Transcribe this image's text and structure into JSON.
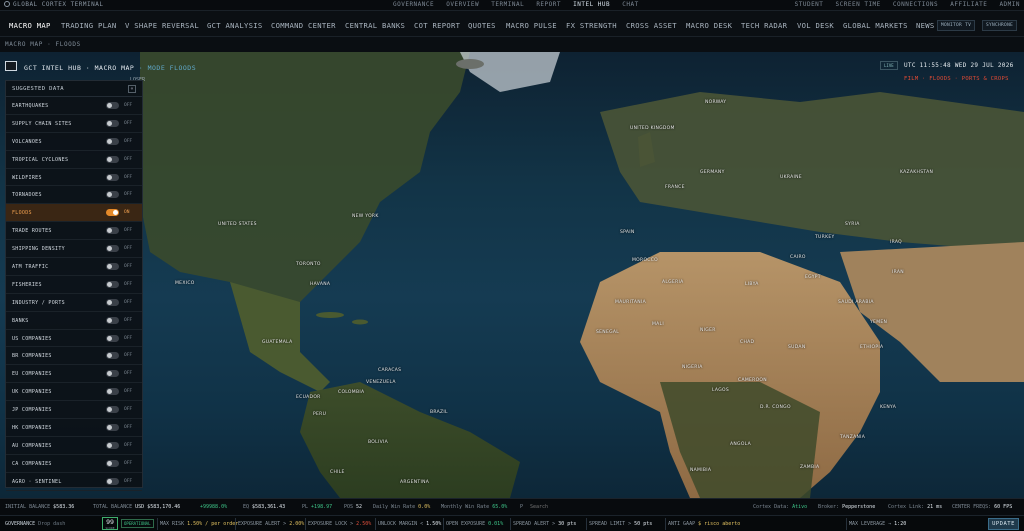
{
  "topbar": {
    "brand": "GLOBAL CORTEX TERMINAL",
    "center_links": [
      "GOVERNANCE",
      "OVERVIEW",
      "TERMINAL",
      "REPORT",
      "INTEL HUB",
      "CHAT"
    ],
    "center_active": "INTEL HUB",
    "right_links": [
      "STUDENT",
      "SCREEN TIME",
      "CONNECTIONS",
      "AFFILIATE",
      "ADMIN"
    ]
  },
  "navbar": {
    "items": [
      "MACRO MAP",
      "TRADING PLAN",
      "V SHAPE REVERSAL",
      "GCT ANALYSIS",
      "COMMAND CENTER",
      "CENTRAL BANKS",
      "COT REPORT",
      "QUOTES",
      "MACRO PULSE",
      "FX STRENGTH",
      "CROSS ASSET",
      "MACRO DESK",
      "TECH RADAR",
      "VOL DESK",
      "GLOBAL MARKETS",
      "NEWS"
    ],
    "active": "MACRO MAP",
    "btn_1": "MONITOR TV",
    "btn_2": "SYNCHRONE"
  },
  "subbar": {
    "title": "MACRO MAP · FLOODS"
  },
  "map_header": {
    "title": "GCT INTEL HUB · MACRO MAP",
    "mode": " · MODE FLOODS",
    "live_badge": "LIVE",
    "utc": "UTC 11:55:48 WED 29 JUL 2026",
    "filter": "FILM · FLOODS · PORTS & CROPS",
    "ghost": "LOSER"
  },
  "panel": {
    "title": "SUGGESTED DATA",
    "collapse": "«",
    "rows": [
      {
        "label": "EARTHQUAKES",
        "state": "OFF"
      },
      {
        "label": "SUPPLY CHAIN SITES",
        "state": "OFF"
      },
      {
        "label": "VOLCANOES",
        "state": "OFF"
      },
      {
        "label": "TROPICAL CYCLONES",
        "state": "OFF"
      },
      {
        "label": "WILDFIRES",
        "state": "OFF"
      },
      {
        "label": "TORNADOES",
        "state": "OFF"
      },
      {
        "label": "FLOODS",
        "state": "ON"
      },
      {
        "label": "TRADE ROUTES",
        "state": "OFF"
      },
      {
        "label": "SHIPPING DENSITY",
        "state": "OFF"
      },
      {
        "label": "ATM TRAFFIC",
        "state": "OFF"
      },
      {
        "label": "FISHERIES",
        "state": "OFF"
      },
      {
        "label": "INDUSTRY / PORTS",
        "state": "OFF"
      },
      {
        "label": "BANKS",
        "state": "OFF"
      },
      {
        "label": "US COMPANIES",
        "state": "OFF"
      },
      {
        "label": "BR COMPANIES",
        "state": "OFF"
      },
      {
        "label": "EU COMPANIES",
        "state": "OFF"
      },
      {
        "label": "UK COMPANIES",
        "state": "OFF"
      },
      {
        "label": "JP COMPANIES",
        "state": "OFF"
      },
      {
        "label": "HK COMPANIES",
        "state": "OFF"
      },
      {
        "label": "AU COMPANIES",
        "state": "OFF"
      },
      {
        "label": "CA COMPANIES",
        "state": "OFF"
      },
      {
        "label": "AGRO · SENTINEL",
        "state": "OFF"
      }
    ]
  },
  "map_labels": [
    "UNITED KINGDOM",
    "UNITED STATES",
    "MEXICO",
    "COLOMBIA",
    "PERU",
    "BRAZIL",
    "BOLIVIA",
    "ALGERIA",
    "LIBYA",
    "EGYPT",
    "NIGER",
    "MALI",
    "CHAD",
    "SUDAN",
    "NIGERIA",
    "ETHIOPIA",
    "D.R. CONGO",
    "ANGOLA",
    "NAMIBIA",
    "SAUDI ARABIA",
    "IRAN",
    "TURKEY",
    "SPAIN",
    "FRANCE",
    "GERMANY",
    "NORWAY",
    "UKRAINE",
    "KAZAKHSTAN",
    "NEW YORK",
    "TORONTO",
    "HAVANA",
    "CARACAS",
    "LAGOS",
    "CAIRO",
    "GUATEMALA",
    "VENEZUELA",
    "ECUADOR",
    "CHILE",
    "ARGENTINA",
    "CAMEROON",
    "KENYA",
    "TANZANIA",
    "ZAMBIA",
    "YEMEN",
    "IRAQ",
    "SYRIA",
    "MOROCCO",
    "MAURITANIA",
    "SENEGAL"
  ],
  "statbar": {
    "initial_label": "INITIAL BALANCE",
    "initial_val": "$583.36",
    "total_label": "TOTAL BALANCE",
    "total_val": "USD $583,170.46",
    "delta_val": "+99988.0%",
    "eq_label": "EQ",
    "eq_val": "$583,361.43",
    "pl_label": "PL",
    "pl_val": "+198.97",
    "pos_label": "POS",
    "pos_val": "52",
    "daily_label": "Daily Win Rate",
    "daily_val": "0.0%",
    "monthly_label": "Monthly Win Rate",
    "monthly_val": "65.0%",
    "search_icon": "P",
    "search_placeholder": "Search",
    "cortex_label": "Cortex Data:",
    "cortex_val": "Ativo",
    "broker_label": "Broker:",
    "broker_val": "Pepperstone",
    "link_label": "Cortex Link:",
    "link_val": "21 ms",
    "fps_label": "CENTER FREQS:",
    "fps_val": "60 FPS"
  },
  "govbar": {
    "title": "GOVERNANCE",
    "sub": "Drop dash",
    "score": "99",
    "score_caption": "SCORE",
    "pill": "OPERATIONAL",
    "items": [
      {
        "label": "MAX RISK",
        "value": "1.50% / per order",
        "color": "#e0c060"
      },
      {
        "label": "EXPOSURE ALERT >",
        "value": "2.00%",
        "color": "#e0c060"
      },
      {
        "label": "EXPOSURE LOCK >",
        "value": "2.50%",
        "color": "#e0503c"
      },
      {
        "label": "UNLOCK MARGIN <",
        "value": "1.50%",
        "color": "#dfe6ec"
      },
      {
        "label": "OPEN EXPOSURE",
        "value": "0.01%",
        "color": "#3fc78a"
      },
      {
        "label": "SPREAD ALERT >",
        "value": "30 pts",
        "color": "#dfe6ec"
      },
      {
        "label": "SPREAD LIMIT >",
        "value": "50 pts",
        "color": "#dfe6ec"
      },
      {
        "label": "ANTI GAAP",
        "value": "$ risco aberto",
        "color": "#e0c060"
      },
      {
        "label": "MAX LEVERAGE →",
        "value": "1:20",
        "color": "#dfe6ec"
      }
    ],
    "update_btn": "UPDATE"
  },
  "colors": {
    "accent": "#e58a2a",
    "filter": "#e04a34",
    "ok": "#3fc78a"
  }
}
